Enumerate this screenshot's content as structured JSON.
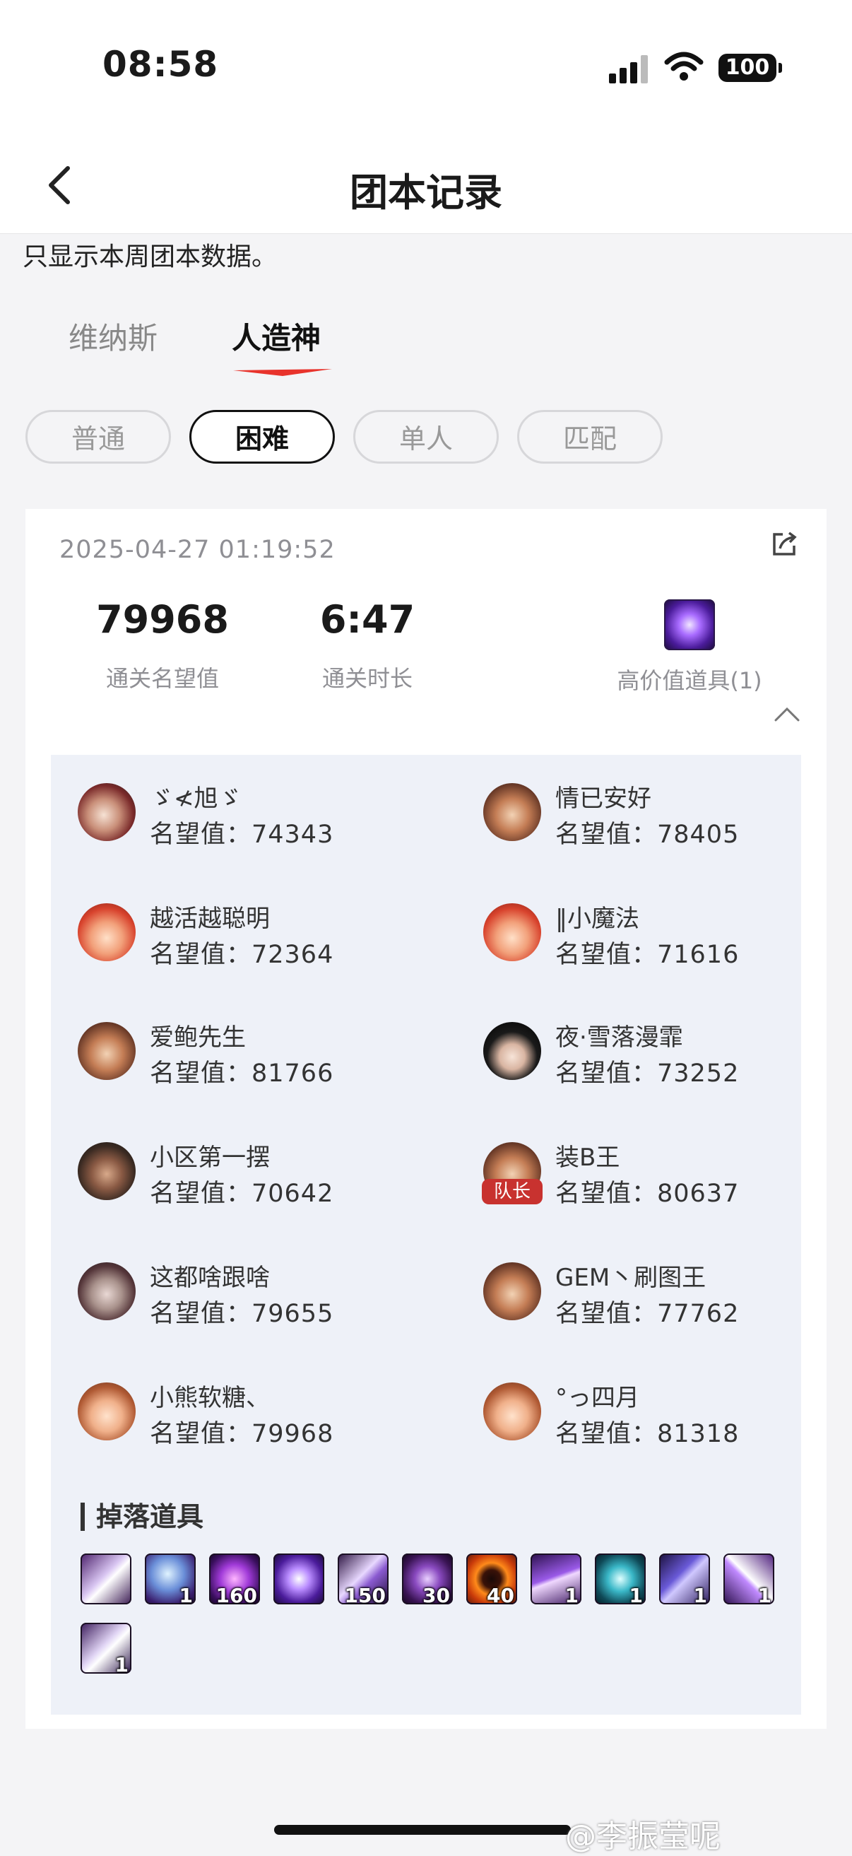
{
  "status": {
    "time": "08:58",
    "battery": "100"
  },
  "nav": {
    "title": "团本记录"
  },
  "notice": "只显示本周团本数据。",
  "tabs": [
    {
      "label": "维纳斯"
    },
    {
      "label": "人造神"
    }
  ],
  "filters": [
    {
      "label": "普通"
    },
    {
      "label": "困难"
    },
    {
      "label": "单人"
    },
    {
      "label": "匹配"
    }
  ],
  "record": {
    "timestamp": "2025-04-27 01:19:52",
    "fame_value": "79968",
    "fame_label": "通关名望值",
    "duration_value": "6:47",
    "duration_label": "通关时长",
    "high_value_label": "高价值道具(1)"
  },
  "members": [
    {
      "name": "ゞ≮旭ゞ",
      "score": "名望值：74343"
    },
    {
      "name": "情已安好",
      "score": "名望值：78405"
    },
    {
      "name": "越活越聪明",
      "score": "名望值：72364"
    },
    {
      "name": "‖小魔法",
      "score": "名望值：71616"
    },
    {
      "name": "爱鲍先生",
      "score": "名望值：81766"
    },
    {
      "name": "夜·雪落漫霏",
      "score": "名望值：73252"
    },
    {
      "name": "小区第一摆",
      "score": "名望值：70642"
    },
    {
      "name": "装Β王",
      "score": "名望值：80637"
    },
    {
      "name": "这都啥跟啥",
      "score": "名望值：79655"
    },
    {
      "name": "GEM丶刷图王",
      "score": "名望值：77762"
    },
    {
      "name": "小熊软糖、",
      "score": "名望值：79968"
    },
    {
      "name": "°っ四月",
      "score": "名望值：81318"
    }
  ],
  "leader_badge": "队长",
  "drops": {
    "title": "掉落道具",
    "items": [
      {
        "count": ""
      },
      {
        "count": "1"
      },
      {
        "count": "160"
      },
      {
        "count": ""
      },
      {
        "count": "150"
      },
      {
        "count": "30"
      },
      {
        "count": "40"
      },
      {
        "count": "1"
      },
      {
        "count": "1"
      },
      {
        "count": "1"
      },
      {
        "count": "1"
      },
      {
        "count": "1"
      }
    ]
  },
  "watermark": "@李振莹呢"
}
